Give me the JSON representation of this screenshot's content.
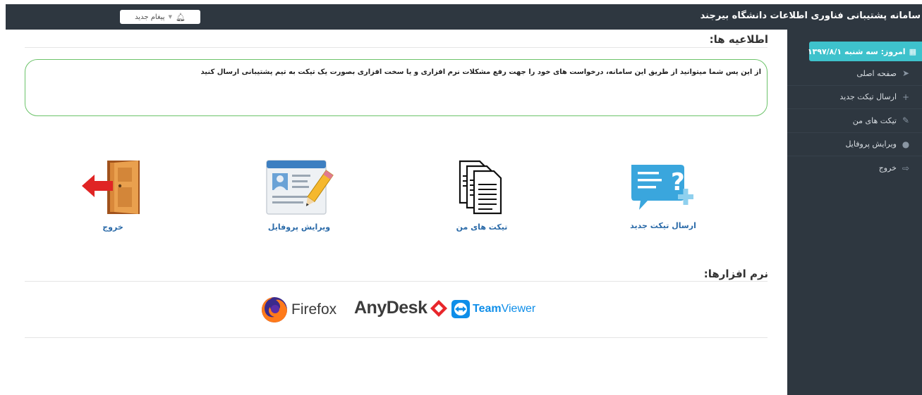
{
  "header": {
    "title": "سامانه پشتیبانی فناوری اطلاعات دانشگاه بیرجند",
    "new_message_label": "پیغام جدید"
  },
  "sidebar": {
    "today_label": "امروز: سه شنبه ۱۳۹۷/۸/۱",
    "items": [
      {
        "label": "صفحه اصلی",
        "icon": "paper-plane-icon"
      },
      {
        "label": "ارسال تیکت جدید",
        "icon": "plus-icon"
      },
      {
        "label": "تیکت های من",
        "icon": "pencil-icon"
      },
      {
        "label": "ویرایش پروفایل",
        "icon": "user-icon"
      },
      {
        "label": "خروج",
        "icon": "sign-out-icon"
      }
    ]
  },
  "announcements": {
    "title": "اطلاعیه ها:",
    "text": "از این پس شما میتوانید از طریق این سامانه، درخواست های خود را جهت رفع مشکلات نرم افزاری و یا سخت افزاری بصورت یک تیکت به تیم پشتیبانی ارسال کنید"
  },
  "tiles": [
    {
      "label": "ارسال تیکت جدید",
      "icon": "new-ticket-icon"
    },
    {
      "label": "تیکت های من",
      "icon": "documents-icon"
    },
    {
      "label": "ویرایش پروفایل",
      "icon": "profile-card-icon"
    },
    {
      "label": "خروج",
      "icon": "exit-door-icon"
    }
  ],
  "software": {
    "title": "نرم افزارها:",
    "items": [
      {
        "name": "Firefox"
      },
      {
        "name": "AnyDesk"
      },
      {
        "name_part1": "Team",
        "name_part2": "Viewer"
      }
    ]
  },
  "colors": {
    "topbar": "#2e3740",
    "sidebar": "#2e3740",
    "accent": "#3ec2cc",
    "notice_border": "#6cc36a",
    "tile_label": "#2a6aa8"
  }
}
